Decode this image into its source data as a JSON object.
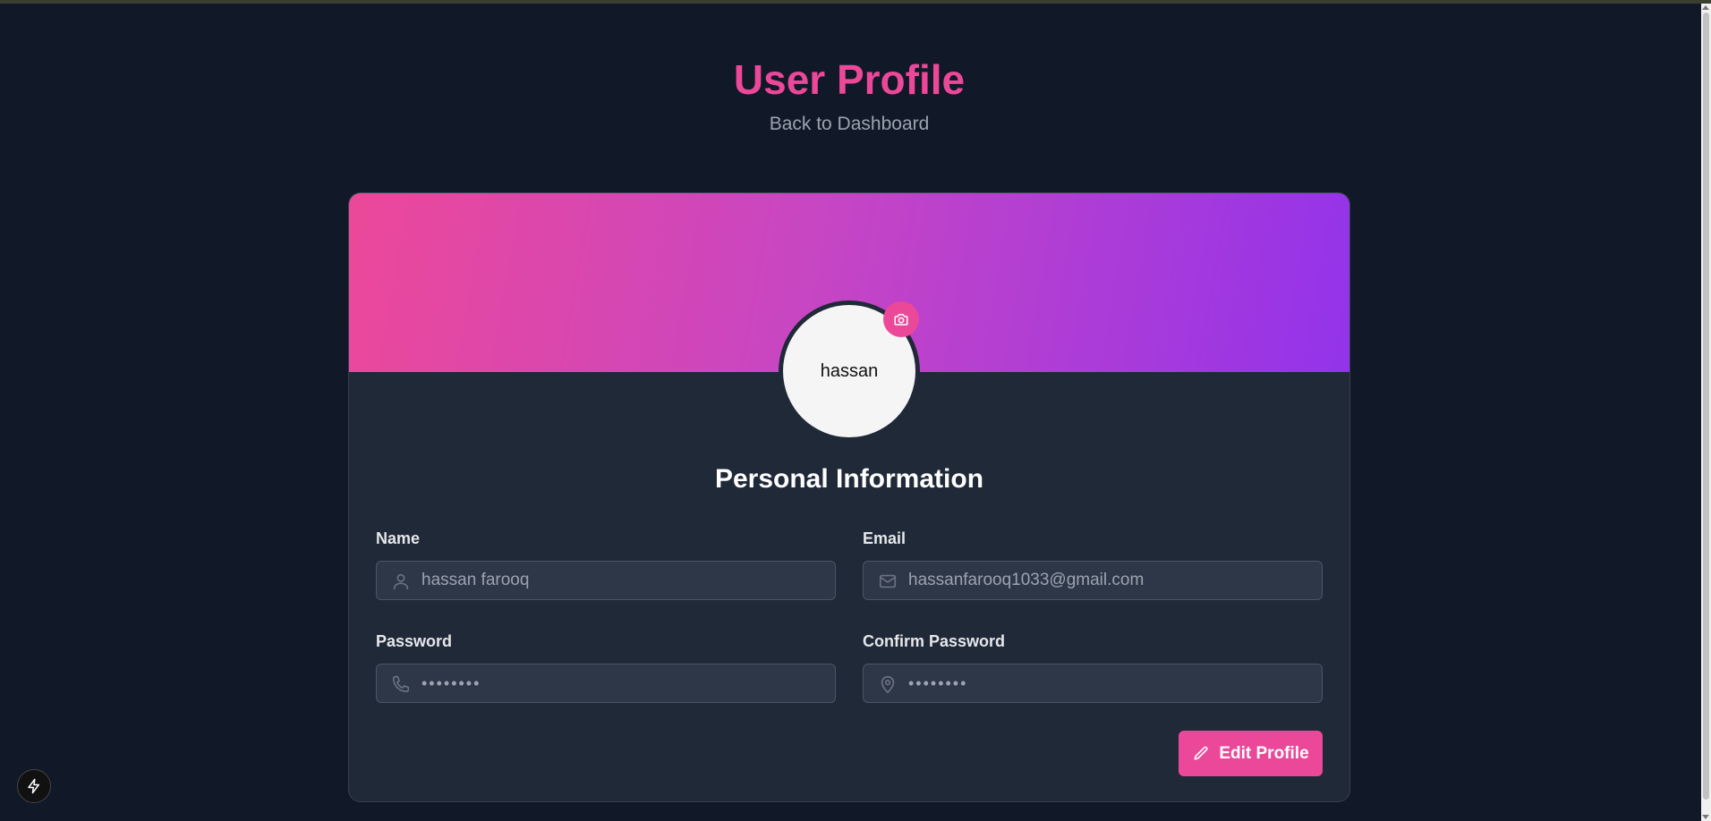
{
  "page": {
    "title": "User Profile",
    "back_link": "Back to Dashboard"
  },
  "profile": {
    "avatar_text": "hassan",
    "section_title": "Personal Information",
    "fields": {
      "name": {
        "label": "Name",
        "value": "hassan farooq",
        "icon": "user-icon"
      },
      "email": {
        "label": "Email",
        "value": "hassanfarooq1033@gmail.com",
        "icon": "mail-icon"
      },
      "password": {
        "label": "Password",
        "value": "••••••••",
        "icon": "phone-icon"
      },
      "confirm_password": {
        "label": "Confirm Password",
        "value": "••••••••",
        "icon": "map-pin-icon"
      }
    },
    "edit_button": "Edit Profile"
  },
  "colors": {
    "background": "#111827",
    "card": "#1f2937",
    "accent": "#ec4899",
    "gradient_end": "#9333ea"
  }
}
